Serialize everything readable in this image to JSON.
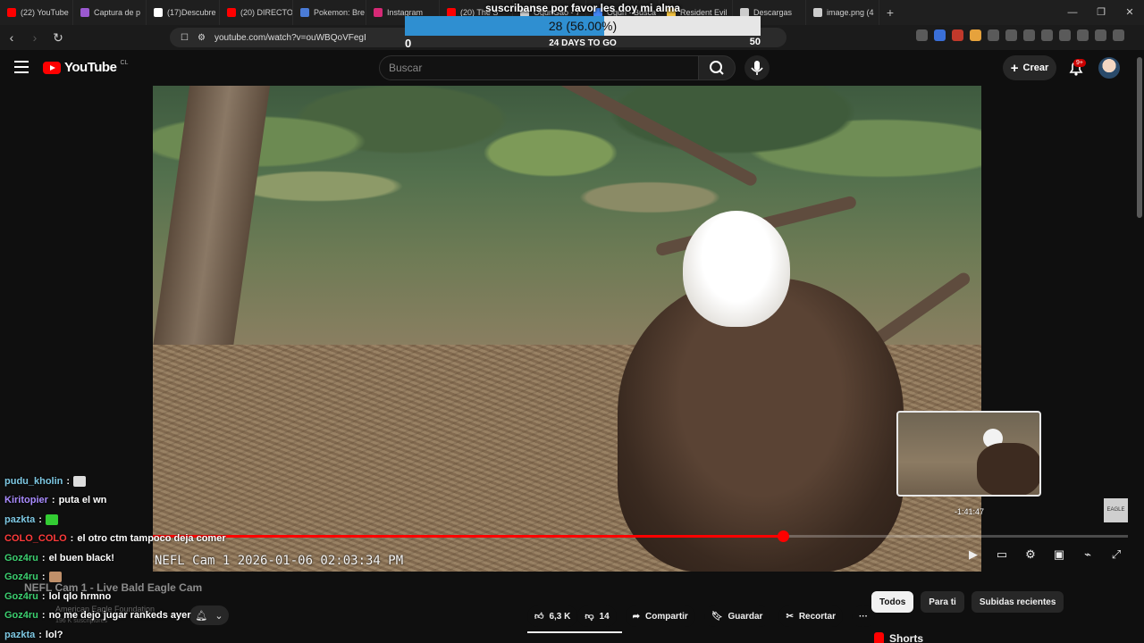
{
  "browser": {
    "tabs": [
      {
        "label": "(22) YouTube",
        "color": "#ff0000"
      },
      {
        "label": "Captura de p",
        "color": "#9b59d0"
      },
      {
        "label": "(17)Descubre",
        "color": "#ffffff"
      },
      {
        "label": "(20) DIRECTO",
        "color": "#ff0000"
      },
      {
        "label": "Pokemon: Bre",
        "color": "#4a7bd6"
      },
      {
        "label": "Instagram",
        "color": "#d62976"
      },
      {
        "label": "(20) The S",
        "color": "#ff0000"
      },
      {
        "label": "OguriGao - 7",
        "color": "#cccccc"
      },
      {
        "label": "Oguri - Busca",
        "color": "#4285f4"
      },
      {
        "label": "Resident Evil",
        "color": "#f0c040"
      },
      {
        "label": "Descargas",
        "color": "#cccccc"
      },
      {
        "label": "image.png (4",
        "color": "#cccccc"
      }
    ],
    "url": "youtube.com/watch?v=ouWBQoVFegI"
  },
  "goal_overlay": {
    "title": "suscribanse por favor les doy mi alma",
    "progress_text": "28 (56.00%)",
    "progress_fraction": 0.56,
    "start": "0",
    "end": "50",
    "days_left": "24 DAYS TO GO"
  },
  "youtube": {
    "logo": "YouTube",
    "country": "CL",
    "search_placeholder": "Buscar",
    "create_label": "Crear",
    "notif_badge": "9+"
  },
  "player": {
    "cam_label": "NEFL Cam 1 2026-01-06 02:03:34 PM",
    "played_fraction": 0.76,
    "preview_time": "-1:41:47",
    "watermark": "EAGLE"
  },
  "chat": [
    {
      "user": "pudu_kholin",
      "color": "#7ec8e3",
      "text": "",
      "emote": "#dddddd"
    },
    {
      "user": "Kiritopier",
      "color": "#a98bff",
      "text": "puta el wn",
      "emote": ""
    },
    {
      "user": "pazkta",
      "color": "#7ec8e3",
      "text": "",
      "emote": "#33cc33"
    },
    {
      "user": "COLO_COLO",
      "color": "#ff3b3b",
      "text": "el otro ctm tampoco deja comer",
      "emote": ""
    },
    {
      "user": "Goz4ru",
      "color": "#3cd070",
      "text": "el buen black!",
      "emote": ""
    },
    {
      "user": "Goz4ru",
      "color": "#3cd070",
      "text": "",
      "emote": "#c0906a"
    },
    {
      "user": "Goz4ru",
      "color": "#3cd070",
      "text": "lol qlo hrmno",
      "emote": ""
    },
    {
      "user": "Goz4ru",
      "color": "#3cd070",
      "text": "no me dejo jugar rankeds ayer",
      "emote": ""
    },
    {
      "user": "pazkta",
      "color": "#7ec8e3",
      "text": "lol?",
      "emote": ""
    }
  ],
  "video": {
    "title": "NEFL Cam 1 - Live Bald Eagle Cam",
    "channel": "American Eagle Foundation",
    "subs": "196 K suscriptores"
  },
  "actions": {
    "likes": "6,3 K",
    "dislikes": "14",
    "share": "Compartir",
    "save": "Guardar",
    "clip": "Recortar",
    "more": "···"
  },
  "chips": [
    "Todos",
    "Para ti",
    "Subidas recientes"
  ],
  "shorts_label": "Shorts"
}
